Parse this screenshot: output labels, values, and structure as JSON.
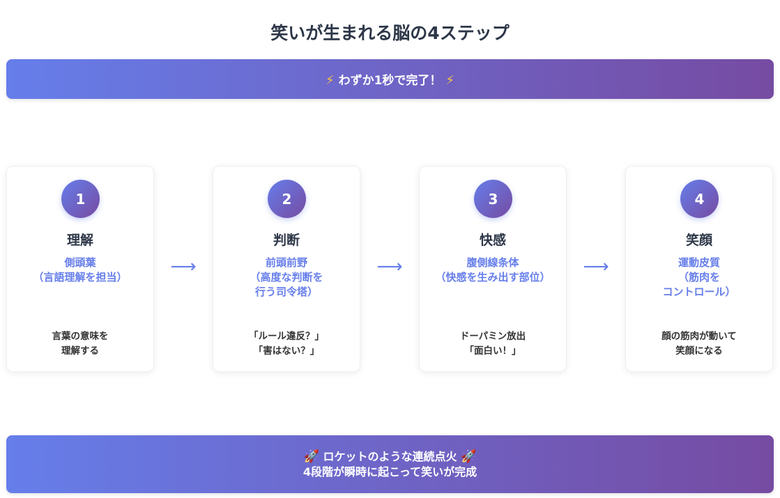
{
  "page": {
    "title": "笑いが生まれる脳の4ステップ"
  },
  "banner_top": {
    "icon": "⚡",
    "text": "わずか1秒で完了！"
  },
  "steps": [
    {
      "number": "1",
      "title": "理解",
      "region": "側頭葉\n（言語理解を担当）",
      "description": "言葉の意味を\n理解する"
    },
    {
      "number": "2",
      "title": "判断",
      "region": "前頭前野\n（高度な判断を\n行う司令塔）",
      "description": "「ルール違反？」\n「害はない？」"
    },
    {
      "number": "3",
      "title": "快感",
      "region": "腹側線条体\n（快感を生み出す部位）",
      "description": "ドーパミン放出\n「面白い！」"
    },
    {
      "number": "4",
      "title": "笑顔",
      "region": "運動皮質\n（筋肉を\nコントロール）",
      "description": "顔の筋肉が動いて\n笑顔になる"
    }
  ],
  "arrow_glyph": "⟶",
  "banner_bottom": {
    "icon": "🚀",
    "line1": "ロケットのような連続点火",
    "line2": "4段階が瞬時に起こって笑いが完成"
  },
  "colors": {
    "gradient_start": "#667eea",
    "gradient_end": "#764ba2",
    "accent": "#667eea",
    "title_text": "#2d3748"
  }
}
